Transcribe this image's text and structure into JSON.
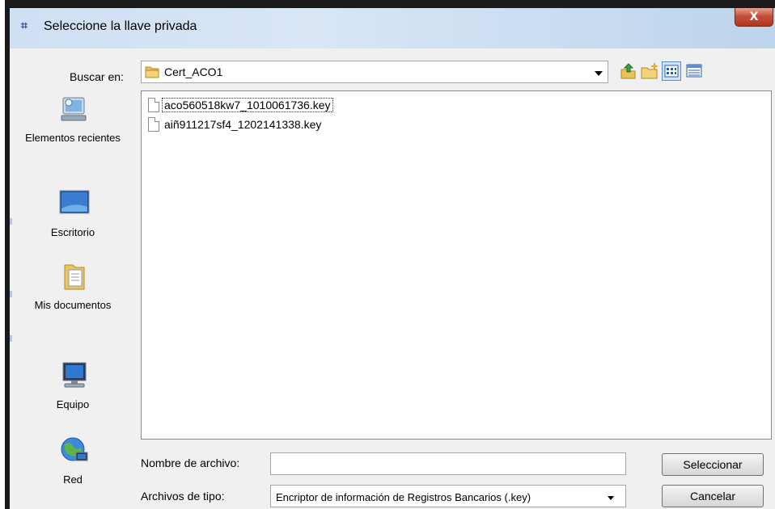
{
  "window": {
    "title": "Seleccione la llave privada",
    "title_icon": "⌗",
    "close_label": "X"
  },
  "lookin": {
    "label": "Buscar en:",
    "value": "Cert_ACO1"
  },
  "toolbar": {
    "icons": [
      "up-one-level-icon",
      "create-new-folder-icon",
      "list-view-icon",
      "details-view-icon"
    ]
  },
  "places": [
    {
      "label": "Elementos recientes",
      "icon": "recent-items-icon"
    },
    {
      "label": "Escritorio",
      "icon": "desktop-icon"
    },
    {
      "label": "Mis documentos",
      "icon": "my-documents-icon"
    },
    {
      "label": "Equipo",
      "icon": "computer-icon"
    },
    {
      "label": "Red",
      "icon": "network-icon"
    }
  ],
  "files": [
    {
      "name": "aco560518kw7_1010061736.key",
      "selected": true
    },
    {
      "name": "aiñ911217sf4_1202141338.key",
      "selected": false
    }
  ],
  "filename": {
    "label": "Nombre de archivo:",
    "value": ""
  },
  "filetype": {
    "label": "Archivos de tipo:",
    "value": "Encriptor de información de Registros Bancarios (.key)"
  },
  "buttons": {
    "select": "Seleccionar",
    "cancel": "Cancelar"
  },
  "colors": {
    "title_bar": "#cfe0f2",
    "close_button": "#c7513b",
    "dialog_bg": "#f0f0f0"
  }
}
